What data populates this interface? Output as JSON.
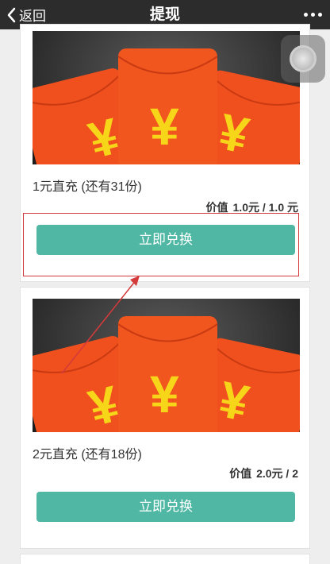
{
  "nav": {
    "back_label": "返回",
    "title": "提现",
    "more_icon": "more-dots-icon"
  },
  "items": [
    {
      "banner_symbol": "¥",
      "title": "1元直充 (还有31份)",
      "price_label": "价值",
      "price_value": "1.0元 / 1.0 元",
      "button_label": "立即兑换"
    },
    {
      "banner_symbol": "¥",
      "title": "2元直充 (还有18份)",
      "price_label": "价值",
      "price_value": "2.0元 / 2",
      "button_label": "立即兑换"
    }
  ],
  "colors": {
    "navbar": "#2c2c2c",
    "button": "#4fb7a3",
    "envelope": "#f0501e",
    "symbol": "#f7d61a",
    "annotation": "#d43a3a"
  }
}
